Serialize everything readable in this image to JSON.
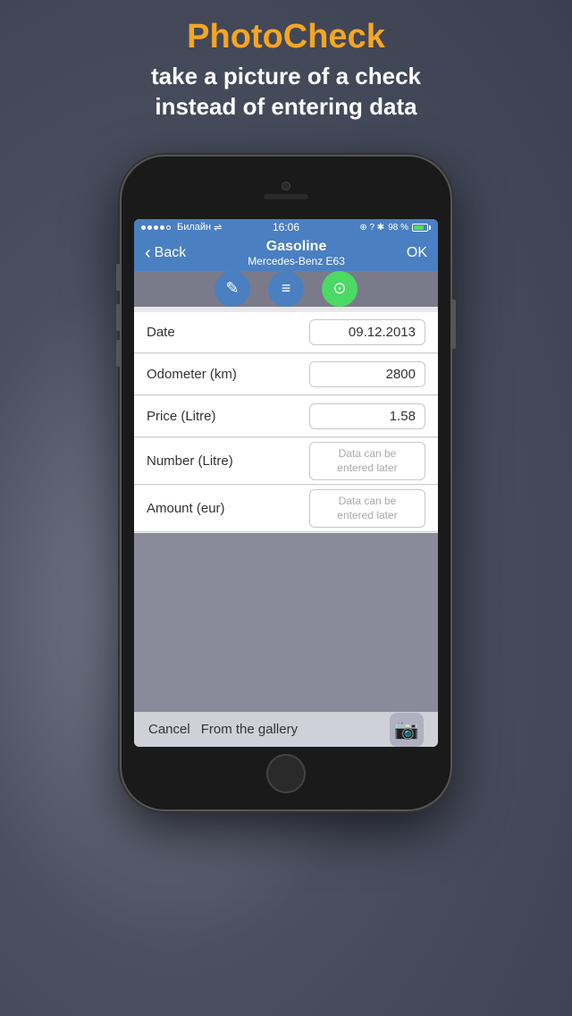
{
  "header": {
    "app_title": "PhotoCheck",
    "subtitle_line1": "take a picture of a check",
    "subtitle_line2": "instead of entering data"
  },
  "status_bar": {
    "carrier": "Билайн",
    "time": "16:06",
    "battery_percent": "98 %",
    "signal_dots": 5,
    "wifi_icon": "⌾"
  },
  "nav_bar": {
    "back_label": "Back",
    "title_main": "Gasoline",
    "title_sub": "Mercedes-Benz E63",
    "ok_label": "OK"
  },
  "toolbar": {
    "edit_icon": "✎",
    "list_icon": "☰",
    "camera_icon": "⊙"
  },
  "form": {
    "rows": [
      {
        "label": "Date",
        "value": "09.12.2013",
        "placeholder": false
      },
      {
        "label": "Odometer (km)",
        "value": "2800",
        "placeholder": false
      },
      {
        "label": "Price (Litre)",
        "value": "1.58",
        "placeholder": false
      },
      {
        "label": "Number (Litre)",
        "value": "Data can be\nentered later",
        "placeholder": true
      },
      {
        "label": "Amount (eur)",
        "value": "Data can be\nentered later",
        "placeholder": true
      }
    ]
  },
  "bottom_bar": {
    "cancel_label": "Cancel",
    "gallery_label": "From the gallery",
    "camera_icon": "📷"
  },
  "colors": {
    "accent": "#f5a623",
    "nav_blue": "#4a7fc1",
    "toolbar_gray": "#7a7a8a",
    "green": "#4cd964"
  }
}
